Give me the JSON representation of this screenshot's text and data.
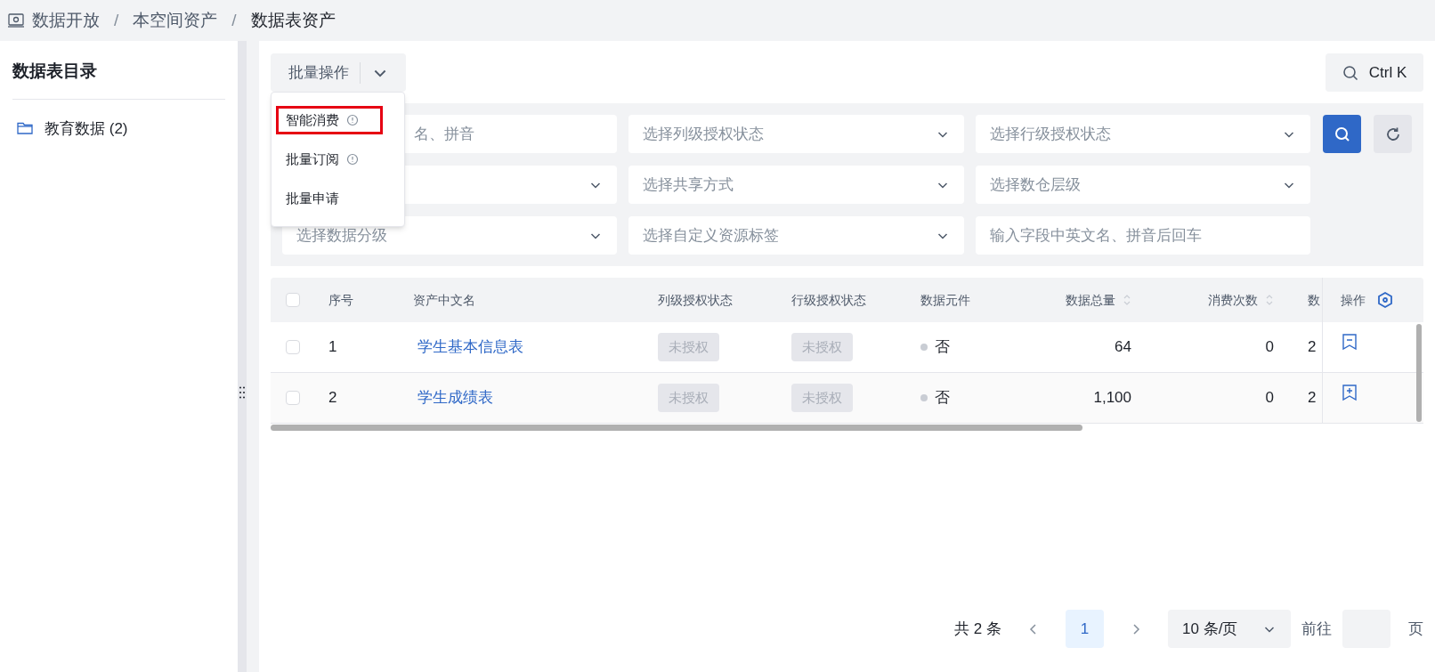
{
  "breadcrumb": [
    {
      "label": "数据开放"
    },
    {
      "label": "本空间资产"
    },
    {
      "label": "数据表资产"
    }
  ],
  "breadcrumb_separator": "/",
  "sidebar": {
    "title": "数据表目录",
    "items": [
      {
        "label": "教育数据 (2)"
      }
    ]
  },
  "toolbar": {
    "batch_button": "批量操作",
    "shortcut": "Ctrl K"
  },
  "batch_menu": [
    {
      "label": "智能消费",
      "info": true,
      "highlighted": true
    },
    {
      "label": "批量订阅",
      "info": true,
      "highlighted": false
    },
    {
      "label": "批量申请",
      "info": false,
      "highlighted": false
    }
  ],
  "filters": [
    {
      "kind": "input",
      "placeholder": "名、拼音"
    },
    {
      "kind": "select",
      "placeholder": "选择列级授权状态"
    },
    {
      "kind": "select",
      "placeholder": "选择行级授权状态"
    },
    {
      "kind": "select"
    },
    {
      "kind": "select",
      "placeholder": "选择共享方式"
    },
    {
      "kind": "select",
      "placeholder": "选择数仓层级"
    },
    {
      "kind": "select",
      "placeholder": "选择数据分级"
    },
    {
      "kind": "select",
      "placeholder": "选择自定义资源标签"
    },
    {
      "kind": "input",
      "placeholder": "输入字段中英文名、拼音后回车"
    }
  ],
  "table": {
    "header_checked": false,
    "columns": [
      {
        "label": "序号",
        "sortable": false
      },
      {
        "label": "资产中文名",
        "sortable": false
      },
      {
        "label": "列级授权状态",
        "sortable": false
      },
      {
        "label": "行级授权状态",
        "sortable": false
      },
      {
        "label": "数据元件",
        "sortable": false
      },
      {
        "label": "数据总量",
        "sortable": true
      },
      {
        "label": "消费次数",
        "sortable": true
      },
      {
        "label": "数",
        "sortable": false
      }
    ],
    "action_column": "操作",
    "rows": [
      {
        "checked": false,
        "index": "1",
        "name": "学生基本信息表",
        "column_auth": "未授权",
        "row_auth": "未授权",
        "element": "否",
        "total": "64",
        "consumed": "0",
        "column_9": "2",
        "action": {
          "kind": "remove"
        }
      },
      {
        "checked": false,
        "index": "2",
        "name": "学生成绩表",
        "column_auth": "未授权",
        "row_auth": "未授权",
        "element": "否",
        "total": "1,100",
        "consumed": "0",
        "column_9": "2",
        "action": {
          "kind": "add"
        }
      }
    ]
  },
  "pagination": {
    "total": "共 2 条",
    "pages": [
      {
        "label": "1",
        "selected": true
      }
    ],
    "page_size": "10 条/页",
    "goto": "前往",
    "page_unit": "页"
  }
}
